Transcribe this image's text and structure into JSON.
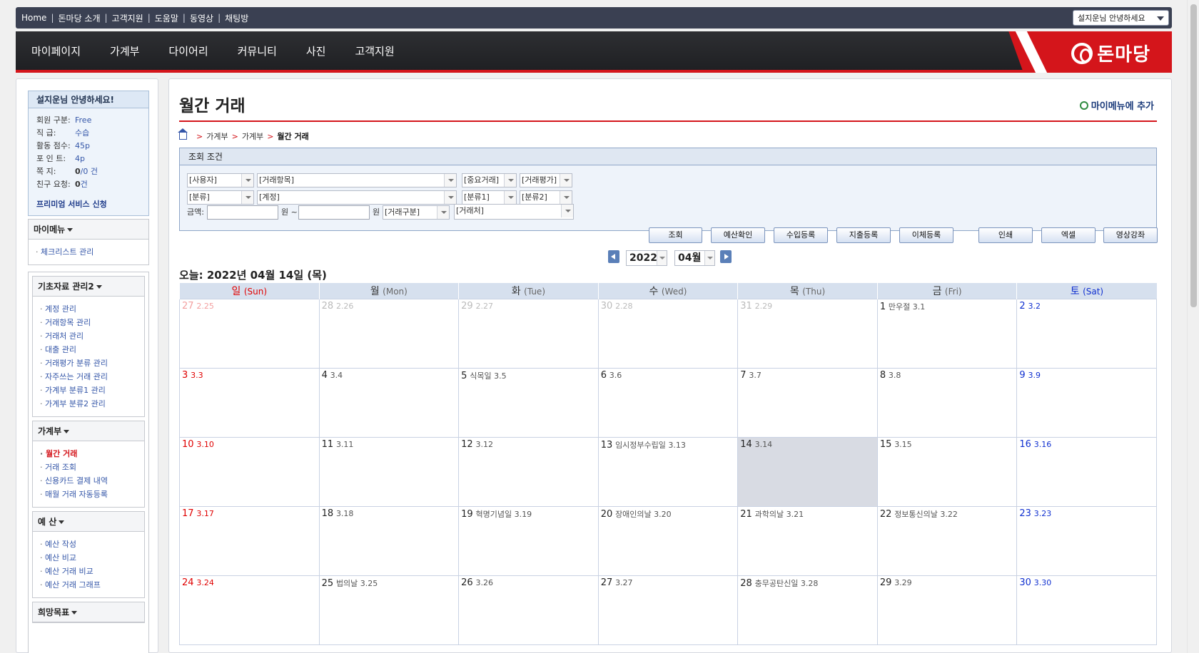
{
  "topbar": {
    "links": [
      "Home",
      "돈마당 소개",
      "고객지원",
      "도움말",
      "동영상",
      "채팅방"
    ],
    "user_greeting": "설지운님 안녕하세요"
  },
  "mainnav": {
    "items": [
      "마이페이지",
      "가계부",
      "다이어리",
      "커뮤니티",
      "사진",
      "고객지원"
    ],
    "logo_text": "돈마당"
  },
  "sidebar": {
    "userbox": {
      "title": "설지운님 안녕하세요!",
      "rows": [
        {
          "key": "회원 구분:",
          "value": "Free"
        },
        {
          "key": "직      급:",
          "value": "수습"
        },
        {
          "key": "활동 점수:",
          "value": "45p"
        },
        {
          "key": "포 인 트:",
          "value": "4p"
        },
        {
          "key": "쪽      지:",
          "value_bold": "0",
          "value": "/0 건"
        },
        {
          "key": "친구 요청:",
          "value_bold": "0",
          "value": "건"
        }
      ],
      "premium_link": "프리미엄 서비스 신청"
    },
    "mymenu": {
      "title": "마이메뉴",
      "items": [
        "체크리스트 관리"
      ]
    },
    "basic": {
      "title": "기초자료 관리2",
      "items": [
        "계정 관리",
        "거래항목 관리",
        "거래처 관리",
        "대출 관리",
        "거래평가 분류 관리",
        "자주쓰는 거래 관리",
        "가계부 분류1 관리",
        "가계부 분류2 관리"
      ]
    },
    "ledger": {
      "title": "가계부",
      "items": [
        "월간 거래",
        "거래 조회",
        "신용카드 결제 내역",
        "매월 거래 자동등록"
      ],
      "active": "월간 거래"
    },
    "budget": {
      "title": "예 산",
      "items": [
        "예산 작성",
        "예산 비교",
        "예산 거래 비교",
        "예산 거래 그래프"
      ]
    },
    "hope": {
      "title": "희망목표"
    }
  },
  "content": {
    "title": "월간 거래",
    "add_menu": "마이메뉴에 추가",
    "breadcrumb": [
      "가계부",
      "가계부",
      "월간 거래"
    ],
    "search": {
      "header": "조회 조건",
      "user": "[사용자]",
      "item": "[거래항목]",
      "important": "[중요거래]",
      "rating": "[거래평가]",
      "category": "[분류]",
      "account": "[계정]",
      "class1": "[분류1]",
      "class2": "[분류2]",
      "amount_label": "금액:",
      "won1": "원 ~",
      "won2": "원",
      "type": "[거래구분]",
      "vendor": "[거래처]"
    },
    "buttons": [
      "조회",
      "예산확인",
      "수입등록",
      "지출등록",
      "이체등록",
      "인쇄",
      "엑셀",
      "영상강좌"
    ],
    "year": "2022",
    "month": "04월",
    "today_label": "오늘: 2022년 04월 14일 (목)"
  },
  "calendar": {
    "headers": [
      {
        "ko": "일",
        "en": "(Sun)"
      },
      {
        "ko": "월",
        "en": "(Mon)"
      },
      {
        "ko": "화",
        "en": "(Tue)"
      },
      {
        "ko": "수",
        "en": "(Wed)"
      },
      {
        "ko": "목",
        "en": "(Thu)"
      },
      {
        "ko": "금",
        "en": "(Fri)"
      },
      {
        "ko": "토",
        "en": "(Sat)"
      }
    ],
    "weeks": [
      [
        {
          "d": "27",
          "s": "2.25",
          "other": true
        },
        {
          "d": "28",
          "s": "2.26",
          "other": true
        },
        {
          "d": "29",
          "s": "2.27",
          "other": true
        },
        {
          "d": "30",
          "s": "2.28",
          "other": true
        },
        {
          "d": "31",
          "s": "2.29",
          "other": true
        },
        {
          "d": "1",
          "s": "만우절 3.1"
        },
        {
          "d": "2",
          "s": "3.2"
        }
      ],
      [
        {
          "d": "3",
          "s": "3.3"
        },
        {
          "d": "4",
          "s": "3.4"
        },
        {
          "d": "5",
          "s": "식목일 3.5"
        },
        {
          "d": "6",
          "s": "3.6"
        },
        {
          "d": "7",
          "s": "3.7"
        },
        {
          "d": "8",
          "s": "3.8"
        },
        {
          "d": "9",
          "s": "3.9"
        }
      ],
      [
        {
          "d": "10",
          "s": "3.10"
        },
        {
          "d": "11",
          "s": "3.11"
        },
        {
          "d": "12",
          "s": "3.12"
        },
        {
          "d": "13",
          "s": "임시정부수립일 3.13"
        },
        {
          "d": "14",
          "s": "3.14",
          "today": true
        },
        {
          "d": "15",
          "s": "3.15"
        },
        {
          "d": "16",
          "s": "3.16"
        }
      ],
      [
        {
          "d": "17",
          "s": "3.17"
        },
        {
          "d": "18",
          "s": "3.18"
        },
        {
          "d": "19",
          "s": "혁명기념일 3.19"
        },
        {
          "d": "20",
          "s": "장애인의날 3.20"
        },
        {
          "d": "21",
          "s": "과학의날 3.21"
        },
        {
          "d": "22",
          "s": "정보통신의날 3.22"
        },
        {
          "d": "23",
          "s": "3.23"
        }
      ],
      [
        {
          "d": "24",
          "s": "3.24"
        },
        {
          "d": "25",
          "s": "법의날 3.25"
        },
        {
          "d": "26",
          "s": "3.26"
        },
        {
          "d": "27",
          "s": "3.27"
        },
        {
          "d": "28",
          "s": "충무공탄신일 3.28"
        },
        {
          "d": "29",
          "s": "3.29"
        },
        {
          "d": "30",
          "s": "3.30"
        }
      ]
    ]
  },
  "colors": {
    "accent": "#d4151b",
    "nav_bg": "#2a2b2f",
    "topbar_bg": "#3a4052",
    "header_bg": "#d6e0ee"
  }
}
